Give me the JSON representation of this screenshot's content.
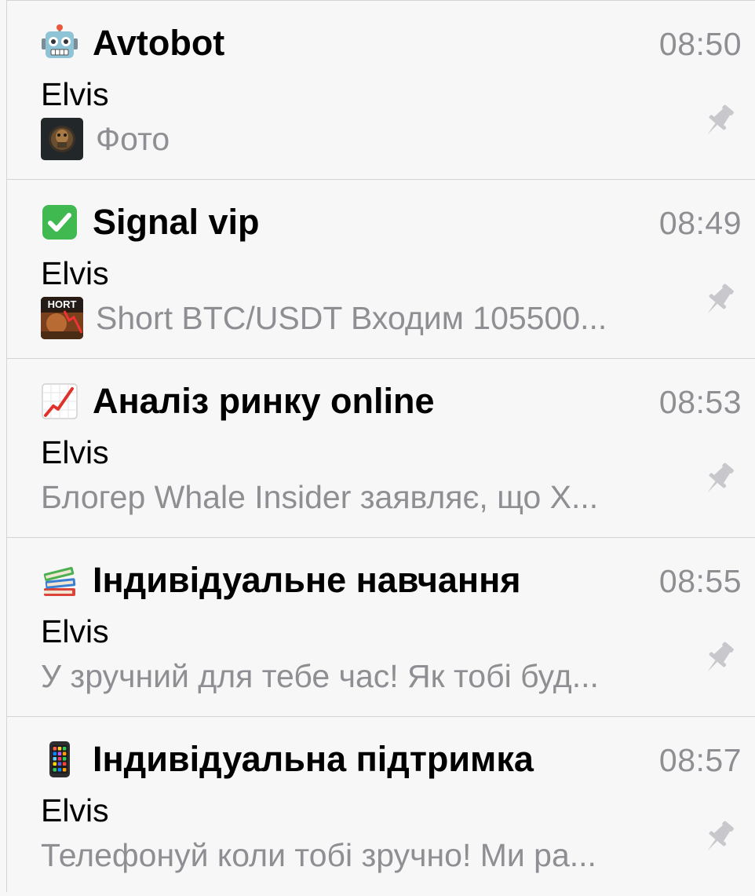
{
  "chats": [
    {
      "icon": "robot-face-icon",
      "title": "Avtobot",
      "time": "08:50",
      "sender": "Elvis",
      "preview": "Фото",
      "thumbnail": "photo-thumbnail",
      "pinned": true
    },
    {
      "icon": "check-mark-button-icon",
      "title": "Signal vip",
      "time": "08:49",
      "sender": "Elvis",
      "preview": "Short BTC/USDT Входим 105500...",
      "thumbnail": "short-chart-thumbnail",
      "pinned": true
    },
    {
      "icon": "chart-increasing-icon",
      "title": "Аналіз ринку online",
      "time": "08:53",
      "sender": "Elvis",
      "preview": "Блогер Whale Insider заявляє, що X...",
      "pinned": true
    },
    {
      "icon": "books-icon",
      "title": "Індивідуальне навчання",
      "time": "08:55",
      "sender": "Elvis",
      "preview": "У зручний для тебе час! Як тобі буд...",
      "pinned": true
    },
    {
      "icon": "mobile-phone-icon",
      "title": "Індивідуальна підтримка",
      "time": "08:57",
      "sender": "Elvis",
      "preview": "Телефонуй коли тобі зручно! Ми ра...",
      "pinned": true
    }
  ],
  "colors": {
    "background": "#f7f7f7",
    "secondary_text": "#8e8e93",
    "separator": "#d4d4d4",
    "pin": "#c7c7cc"
  }
}
